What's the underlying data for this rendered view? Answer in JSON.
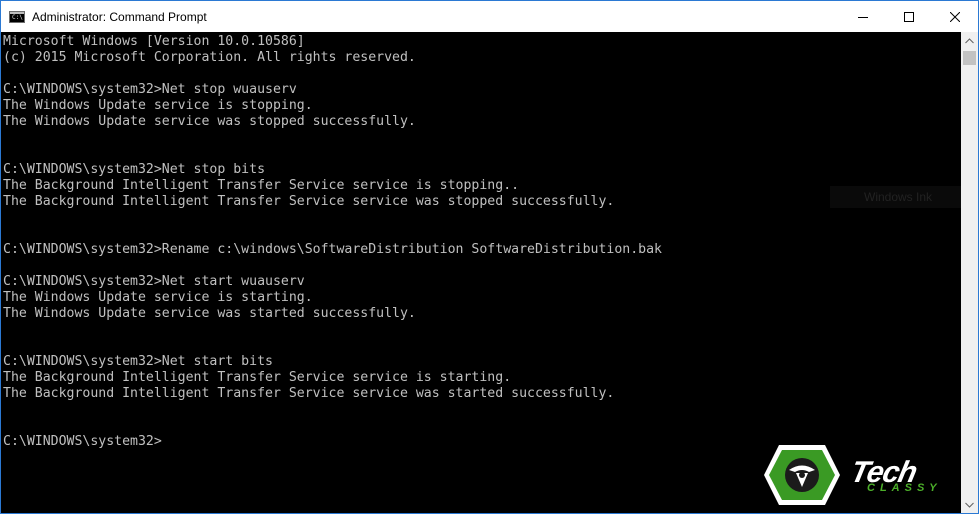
{
  "window": {
    "title": "Administrator: Command Prompt",
    "icon_label": "C:\\"
  },
  "console": {
    "lines": [
      "Microsoft Windows [Version 10.0.10586]",
      "(c) 2015 Microsoft Corporation. All rights reserved.",
      "",
      "C:\\WINDOWS\\system32>Net stop wuauserv",
      "The Windows Update service is stopping.",
      "The Windows Update service was stopped successfully.",
      "",
      "",
      "C:\\WINDOWS\\system32>Net stop bits",
      "The Background Intelligent Transfer Service service is stopping..",
      "The Background Intelligent Transfer Service service was stopped successfully.",
      "",
      "",
      "C:\\WINDOWS\\system32>Rename c:\\windows\\SoftwareDistribution SoftwareDistribution.bak",
      "",
      "C:\\WINDOWS\\system32>Net start wuauserv",
      "The Windows Update service is starting.",
      "The Windows Update service was started successfully.",
      "",
      "",
      "C:\\WINDOWS\\system32>Net start bits",
      "The Background Intelligent Transfer Service service is starting.",
      "The Background Intelligent Transfer Service service was started successfully.",
      "",
      "",
      "C:\\WINDOWS\\system32>"
    ],
    "text_color": "#c0c0c0",
    "background_color": "#000000"
  },
  "ghost_tooltip": "Windows Ink",
  "watermark": {
    "line1": "Tech",
    "line2": "CLASSY",
    "brand_green": "#4caf2a"
  },
  "icons": {
    "minimize": "minimize-icon",
    "maximize": "maximize-icon",
    "close": "close-icon",
    "scroll_up": "chevron-up-icon",
    "scroll_down": "chevron-down-icon"
  }
}
